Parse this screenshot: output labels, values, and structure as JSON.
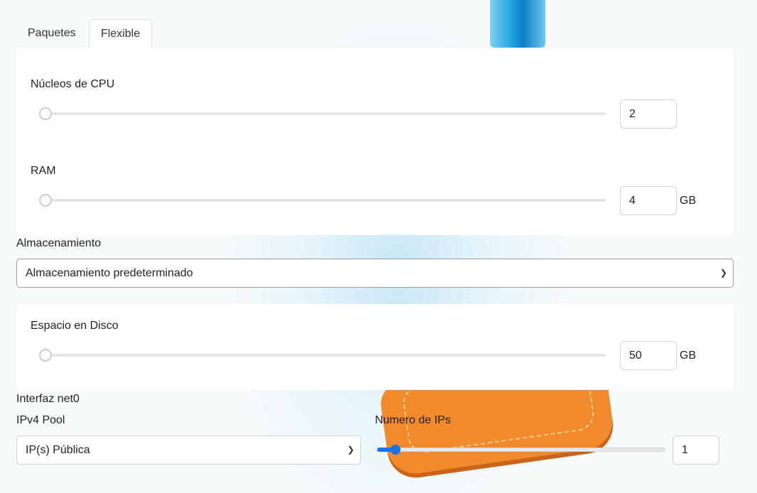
{
  "tabs": [
    {
      "label": "Paquetes",
      "active": false
    },
    {
      "label": "Flexible",
      "active": true
    }
  ],
  "cpu": {
    "label": "Núcleos de CPU",
    "value": "2",
    "level": 0
  },
  "ram": {
    "label": "RAM",
    "value": "4",
    "unit": "GB",
    "level": 0
  },
  "storage": {
    "label": "Almacenamiento",
    "selected": "Almacenamiento predeterminado"
  },
  "disk": {
    "label": "Espacio en Disco",
    "value": "50",
    "unit": "GB",
    "level": 0
  },
  "network": {
    "interface_label": "Interfaz net0",
    "pool_label": "IPv4 Pool",
    "pool_selected": "IP(s) Pública",
    "ips_label": "Numero de IPs",
    "ips_value": "1",
    "ips_level": 0.02
  },
  "colors": {
    "accent": "#1a73e8",
    "decor_orange": "#f08a2c",
    "decor_blue": "#1aa3e0"
  }
}
